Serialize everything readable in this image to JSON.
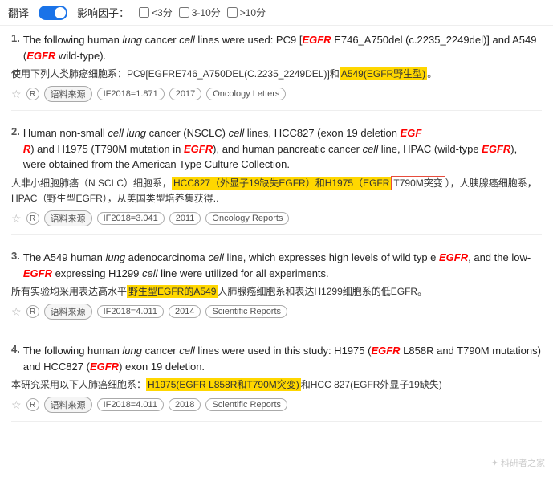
{
  "topbar": {
    "translate_label": "翻译",
    "filter_label": "影响因子：",
    "filter_options": [
      {
        "label": "<3分",
        "value": "lt3"
      },
      {
        "label": "3-10分",
        "value": "3to10"
      },
      {
        "label": ">10分",
        "value": "gt10"
      }
    ]
  },
  "results": [
    {
      "number": "1.",
      "text_en": "The following human lung cancer cell lines were used: PC9 [EGFR E746_A750del (c.2235_2249del)] and A549 (EGFR wild-type).",
      "text_cn": "使用下列人类肺癌细胞系：PC9[EGFRE746_A750DEL(C.2235_2249DEL)]和A549(EGFR野生型)。",
      "cn_highlight": "A549(EGFR野生型)",
      "if_value": "IF2018=1.871",
      "year": "2017",
      "journal": "Oncology Letters"
    },
    {
      "number": "2.",
      "text_en": "Human non-small cell lung cancer (NSCLC) cell lines, HCC827 (exon 19 deletion EGFR) and H1975 (T790M mutation in EGFR), and human pancreatic cancer cell line, HPAC (wild-type EGFR), were obtained from the American Type Culture Collection.",
      "text_cn": "人非小细胞肺癌（N SCLC）细胞系，HCC827（外显子19缺失EGFR）和H1975（EGFR T790M突变），人胰腺癌细胞系，HPAC（野生型EGFR），从美国类型培养集获得..",
      "cn_highlight1": "HCC827（外显子19缺失EGFR）和H1975（EGFR",
      "if_value": "IF2018=3.041",
      "year": "2011",
      "journal": "Oncology Reports"
    },
    {
      "number": "3.",
      "text_en": "The A549 human lung adenocarcinoma cell line, which expresses high levels of wild type EGFR, and the low-EGFR expressing H1299 cell line were utilized for all experiments.",
      "text_cn": "所有实验均采用表达高水平野生型EGFR的A549人肺腺癌细胞系和表达H1299细胞系的低EGFR。",
      "cn_highlight": "野生型EGFR的A549",
      "if_value": "IF2018=4.011",
      "year": "2014",
      "journal": "Scientific Reports"
    },
    {
      "number": "4.",
      "text_en": "The following human lung cancer cell lines were used in this study: H1975 (EGFR L858R and T790M mutations) and HCC827 (EGFR exon 19 deletion.",
      "text_cn": "本研究采用以下人肺癌细胞系：H1975(EGFR L858R和T790M突变)和HCC 827(EGFR外显子19缺失)",
      "cn_highlight": "H1975(EGFR L858R和T790M突变)",
      "if_value": "IF2018=4.011",
      "year": "2018",
      "journal": "Scientific Reports"
    }
  ],
  "labels": {
    "source": "语料来源",
    "watermark": "科研者之家"
  }
}
